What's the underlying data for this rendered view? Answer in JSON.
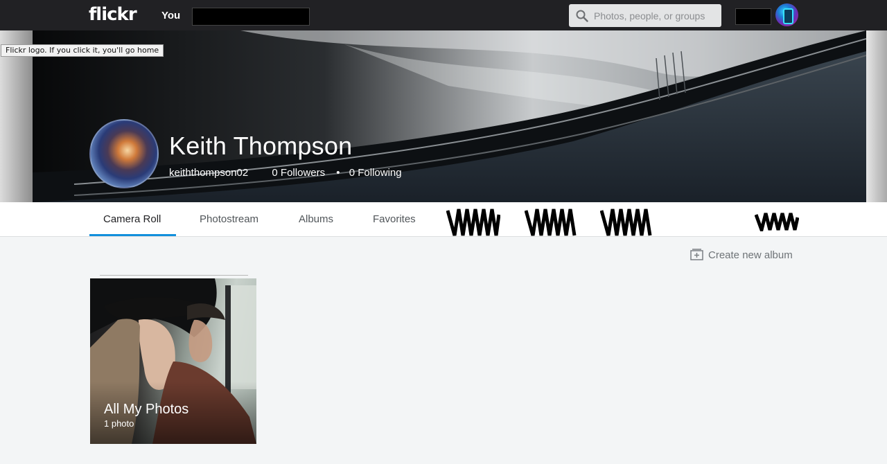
{
  "topbar": {
    "logo": "flickr",
    "nav_you": "You",
    "search_placeholder": "Photos, people, or groups"
  },
  "tooltip": "Flickr logo. If you click it, you'll go home",
  "profile": {
    "name": "Keith Thompson",
    "username": "keiththompson02",
    "followers": "0 Followers",
    "separator": "•",
    "following": "0 Following"
  },
  "tabs": [
    "Camera Roll",
    "Photostream",
    "Albums",
    "Favorites"
  ],
  "active_tab": "Camera Roll",
  "actions": {
    "create_album": "Create new album"
  },
  "albums": [
    {
      "title": "All My Photos",
      "count": "1 photo"
    }
  ],
  "colors": {
    "topbar": "#212124",
    "accent": "#128fdc",
    "page_bg": "#f3f5f6"
  }
}
